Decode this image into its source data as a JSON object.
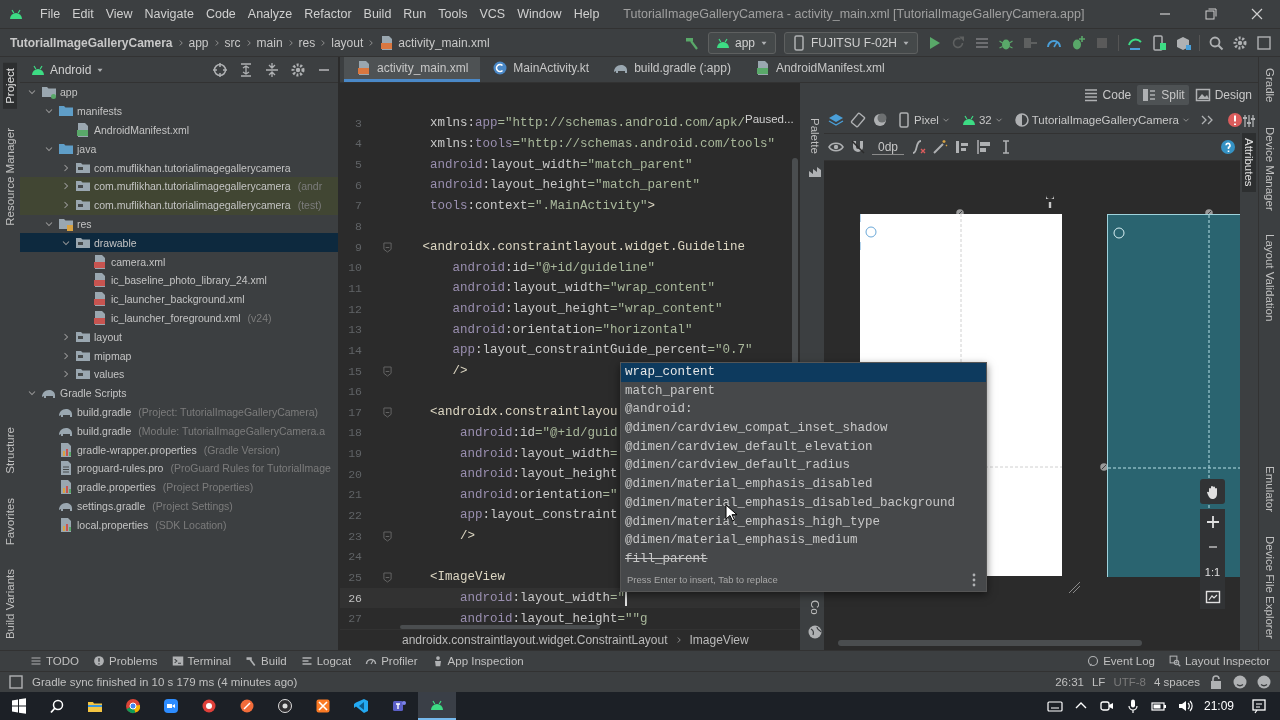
{
  "menu": [
    "File",
    "Edit",
    "View",
    "Navigate",
    "Code",
    "Analyze",
    "Refactor",
    "Build",
    "Run",
    "Tools",
    "VCS",
    "Window",
    "Help"
  ],
  "window_title": "TutorialImageGalleryCamera - activity_main.xml [TutorialImageGalleryCamera.app]",
  "breadcrumb": [
    "TutorialImageGalleryCamera",
    "app",
    "src",
    "main",
    "res",
    "layout",
    "activity_main.xml"
  ],
  "run_config": "app",
  "device": "FUJITSU F-02H",
  "project_view": "Android",
  "editor_tabs": [
    {
      "label": "activity_main.xml",
      "kind": "layout",
      "selected": true
    },
    {
      "label": "MainActivity.kt",
      "kind": "class",
      "selected": false
    },
    {
      "label": "build.gradle (:app)",
      "kind": "gradle",
      "selected": false
    },
    {
      "label": "AndroidManifest.xml",
      "kind": "manifest",
      "selected": false
    }
  ],
  "left_stripe": {
    "top": [
      {
        "label": "Project",
        "selected": true
      },
      {
        "label": "Resource Manager",
        "selected": false
      }
    ],
    "bottom": [
      {
        "label": "Structure",
        "selected": false
      },
      {
        "label": "Favorites",
        "selected": false
      },
      {
        "label": "Build Variants",
        "selected": false
      }
    ]
  },
  "right_stripe": {
    "top": [
      {
        "label": "Gradle"
      },
      {
        "label": "Device Manager"
      },
      {
        "label": "Layout Validation"
      }
    ],
    "bottom": [
      {
        "label": "Emulator"
      },
      {
        "label": "Device File Explorer"
      }
    ]
  },
  "project_tree": [
    {
      "name": "app",
      "kind": "module",
      "expanded": true,
      "selected": false,
      "tinted": false,
      "children": [
        {
          "name": "manifests",
          "kind": "source",
          "expanded": true,
          "selected": false,
          "tinted": false,
          "children": [
            {
              "name": "AndroidManifest.xml",
              "kind": "manifest",
              "selected": false,
              "tinted": false
            }
          ]
        },
        {
          "name": "java",
          "kind": "source",
          "expanded": true,
          "selected": false,
          "tinted": false,
          "children": [
            {
              "name": "com.muflikhan.tutorialimagegallerycamera",
              "kind": "package",
              "expanded": false,
              "selected": false,
              "tinted": false
            },
            {
              "name": "com.muflikhan.tutorialimagegallerycamera",
              "hint": "(andr",
              "kind": "package",
              "expanded": false,
              "selected": false,
              "tinted": true
            },
            {
              "name": "com.muflikhan.tutorialimagegallerycamera",
              "hint": "(test)",
              "kind": "package",
              "expanded": false,
              "selected": false,
              "tinted": true
            }
          ]
        },
        {
          "name": "res",
          "kind": "res",
          "expanded": true,
          "selected": false,
          "tinted": false,
          "children": [
            {
              "name": "drawable",
              "kind": "package",
              "expanded": true,
              "selected": true,
              "tinted": false,
              "children": [
                {
                  "name": "camera.xml",
                  "kind": "xml",
                  "selected": false,
                  "tinted": false
                },
                {
                  "name": "ic_baseline_photo_library_24.xml",
                  "kind": "xml",
                  "selected": false,
                  "tinted": false
                },
                {
                  "name": "ic_launcher_background.xml",
                  "kind": "xml",
                  "selected": false,
                  "tinted": false
                },
                {
                  "name": "ic_launcher_foreground.xml",
                  "hint": "(v24)",
                  "kind": "xml",
                  "selected": false,
                  "tinted": false
                }
              ]
            },
            {
              "name": "layout",
              "kind": "package",
              "expanded": false,
              "selected": false,
              "tinted": false
            },
            {
              "name": "mipmap",
              "kind": "package",
              "expanded": false,
              "selected": false,
              "tinted": false
            },
            {
              "name": "values",
              "kind": "package",
              "expanded": false,
              "selected": false,
              "tinted": false
            }
          ]
        }
      ]
    },
    {
      "name": "Gradle Scripts",
      "kind": "gradle",
      "expanded": true,
      "selected": false,
      "tinted": false,
      "children": [
        {
          "name": "build.gradle",
          "hint": "(Project: TutorialImageGalleryCamera)",
          "kind": "gradle",
          "selected": false,
          "tinted": false
        },
        {
          "name": "build.gradle",
          "hint": "(Module: TutorialImageGalleryCamera.a",
          "kind": "gradle",
          "selected": false,
          "tinted": false
        },
        {
          "name": "gradle-wrapper.properties",
          "hint": "(Gradle Version)",
          "kind": "properties",
          "selected": false,
          "tinted": false
        },
        {
          "name": "proguard-rules.pro",
          "hint": "(ProGuard Rules for TutorialImage",
          "kind": "text",
          "selected": false,
          "tinted": false
        },
        {
          "name": "gradle.properties",
          "hint": "(Project Properties)",
          "kind": "properties",
          "selected": false,
          "tinted": false
        },
        {
          "name": "settings.gradle",
          "hint": "(Project Settings)",
          "kind": "gradle",
          "selected": false,
          "tinted": false
        },
        {
          "name": "local.properties",
          "hint": "(SDK Location)",
          "kind": "properties",
          "selected": false,
          "tinted": false
        }
      ]
    }
  ],
  "code_lines": [
    {
      "number": "3",
      "current": false,
      "fold": false,
      "caret": false,
      "tokens": [
        {
          "kind": "attr",
          "text": "    xmlns:"
        },
        {
          "kind": "ns",
          "text": "app"
        },
        {
          "kind": "str",
          "text": "=\"http://schemas.android.com/apk/"
        }
      ]
    },
    {
      "number": "4",
      "current": false,
      "fold": false,
      "caret": false,
      "tokens": [
        {
          "kind": "attr",
          "text": "    xmlns:"
        },
        {
          "kind": "ns",
          "text": "tools"
        },
        {
          "kind": "str",
          "text": "=\"http://schemas.android.com/tools\""
        }
      ]
    },
    {
      "number": "5",
      "current": false,
      "fold": false,
      "caret": false,
      "tokens": [
        {
          "kind": "ns",
          "text": "    android"
        },
        {
          "kind": "attr",
          "text": ":layout_width"
        },
        {
          "kind": "str",
          "text": "=\"match_parent\""
        }
      ]
    },
    {
      "number": "6",
      "current": false,
      "fold": false,
      "caret": false,
      "tokens": [
        {
          "kind": "ns",
          "text": "    android"
        },
        {
          "kind": "attr",
          "text": ":layout_height"
        },
        {
          "kind": "str",
          "text": "=\"match_parent\""
        }
      ]
    },
    {
      "number": "7",
      "current": false,
      "fold": false,
      "caret": false,
      "tokens": [
        {
          "kind": "ns",
          "text": "    tools"
        },
        {
          "kind": "attr",
          "text": ":context"
        },
        {
          "kind": "str",
          "text": "=\".MainActivity\""
        },
        {
          "kind": "tag",
          "text": ">"
        }
      ]
    },
    {
      "number": "8",
      "current": false,
      "fold": false,
      "caret": false
    },
    {
      "number": "9",
      "current": false,
      "fold": true,
      "caret": false,
      "tokens": [
        {
          "kind": "tag",
          "text": "   <androidx.constraintlayout.widget.Guideline"
        }
      ]
    },
    {
      "number": "10",
      "current": false,
      "fold": false,
      "caret": false,
      "tokens": [
        {
          "kind": "ns",
          "text": "       android"
        },
        {
          "kind": "attr",
          "text": ":id"
        },
        {
          "kind": "str",
          "text": "=\"@+id/guideline\""
        }
      ]
    },
    {
      "number": "11",
      "current": false,
      "fold": false,
      "caret": false,
      "tokens": [
        {
          "kind": "ns",
          "text": "       android"
        },
        {
          "kind": "attr",
          "text": ":layout_width"
        },
        {
          "kind": "str",
          "text": "=\"wrap_content\""
        }
      ]
    },
    {
      "number": "12",
      "current": false,
      "fold": false,
      "caret": false,
      "tokens": [
        {
          "kind": "ns",
          "text": "       android"
        },
        {
          "kind": "attr",
          "text": ":layout_height"
        },
        {
          "kind": "str",
          "text": "=\"wrap_content\""
        }
      ]
    },
    {
      "number": "13",
      "current": false,
      "fold": false,
      "caret": false,
      "tokens": [
        {
          "kind": "ns",
          "text": "       android"
        },
        {
          "kind": "attr",
          "text": ":orientation"
        },
        {
          "kind": "str",
          "text": "=\"horizontal\""
        }
      ]
    },
    {
      "number": "14",
      "current": false,
      "fold": false,
      "caret": false,
      "tokens": [
        {
          "kind": "ns",
          "text": "       app"
        },
        {
          "kind": "attr",
          "text": ":layout_constraintGuide_percent"
        },
        {
          "kind": "str",
          "text": "=\"0.7\""
        }
      ]
    },
    {
      "number": "15",
      "current": false,
      "fold": true,
      "caret": false,
      "tokens": [
        {
          "kind": "tag",
          "text": "       />"
        }
      ]
    },
    {
      "number": "16",
      "current": false,
      "fold": false,
      "caret": false
    },
    {
      "number": "17",
      "current": false,
      "fold": true,
      "caret": false,
      "tokens": [
        {
          "kind": "tag",
          "text": "    <androidx.constraintlayou"
        }
      ]
    },
    {
      "number": "18",
      "current": false,
      "fold": false,
      "caret": false,
      "tokens": [
        {
          "kind": "ns",
          "text": "        android"
        },
        {
          "kind": "attr",
          "text": ":id"
        },
        {
          "kind": "str",
          "text": "=\"@+id/guid"
        }
      ]
    },
    {
      "number": "19",
      "current": false,
      "fold": false,
      "caret": false,
      "tokens": [
        {
          "kind": "ns",
          "text": "        android"
        },
        {
          "kind": "attr",
          "text": ":layout_width"
        },
        {
          "kind": "str",
          "text": "="
        }
      ]
    },
    {
      "number": "20",
      "current": false,
      "fold": false,
      "caret": false,
      "tokens": [
        {
          "kind": "ns",
          "text": "        android"
        },
        {
          "kind": "attr",
          "text": ":layout_height"
        }
      ]
    },
    {
      "number": "21",
      "current": false,
      "fold": false,
      "caret": false,
      "tokens": [
        {
          "kind": "ns",
          "text": "        android"
        },
        {
          "kind": "attr",
          "text": ":orientation"
        },
        {
          "kind": "str",
          "text": "=\""
        }
      ]
    },
    {
      "number": "22",
      "current": false,
      "fold": false,
      "caret": false,
      "tokens": [
        {
          "kind": "ns",
          "text": "        app"
        },
        {
          "kind": "attr",
          "text": ":layout_constraint"
        }
      ]
    },
    {
      "number": "23",
      "current": false,
      "fold": true,
      "caret": false,
      "tokens": [
        {
          "kind": "tag",
          "text": "        />"
        }
      ]
    },
    {
      "number": "24",
      "current": false,
      "fold": false,
      "caret": false
    },
    {
      "number": "25",
      "current": false,
      "fold": true,
      "caret": false,
      "tokens": [
        {
          "kind": "tag",
          "text": "    <ImageView"
        }
      ]
    },
    {
      "number": "26",
      "current": true,
      "fold": false,
      "caret": true,
      "tokens": [
        {
          "kind": "ns",
          "text": "        android"
        },
        {
          "kind": "attr",
          "text": ":layout_width"
        },
        {
          "kind": "str",
          "text": "=\""
        }
      ]
    },
    {
      "number": "27",
      "current": false,
      "fold": false,
      "caret": false,
      "tokens": [
        {
          "kind": "ns",
          "text": "        android"
        },
        {
          "kind": "attr",
          "text": ":layout_height"
        },
        {
          "kind": "str",
          "text": "=\"\"g"
        }
      ]
    }
  ],
  "paused_label": "Paused...",
  "completion": {
    "items": [
      {
        "text": "wrap_content",
        "kind": "value",
        "selected": true
      },
      {
        "text": "match_parent",
        "kind": "value",
        "selected": false
      },
      {
        "text": "@android:",
        "kind": "value",
        "selected": false
      },
      {
        "text": "@dimen/cardview_compat_inset_shadow",
        "kind": "value",
        "selected": false
      },
      {
        "text": "@dimen/cardview_default_elevation",
        "kind": "value",
        "selected": false
      },
      {
        "text": "@dimen/cardview_default_radius",
        "kind": "value",
        "selected": false
      },
      {
        "text": "@dimen/material_emphasis_disabled",
        "kind": "value",
        "selected": false
      },
      {
        "text": "@dimen/material_emphasis_disabled_background",
        "kind": "value",
        "selected": false
      },
      {
        "text": "@dimen/material_emphasis_high_type",
        "kind": "value",
        "selected": false
      },
      {
        "text": "@dimen/material_emphasis_medium",
        "kind": "value",
        "selected": false
      },
      {
        "text": "fill_parent",
        "kind": "deprecated",
        "selected": false
      }
    ],
    "footer": "Press Enter to insert, Tab to replace"
  },
  "editor_breadcrumb": [
    "androidx.constraintlayout.widget.ConstraintLayout",
    "ImageView"
  ],
  "design": {
    "modes": [
      {
        "label": "Code",
        "kind": "code",
        "selected": false
      },
      {
        "label": "Split",
        "kind": "split",
        "selected": true
      },
      {
        "label": "Design",
        "kind": "design",
        "selected": false
      }
    ],
    "palette_label": "Palette",
    "component_tree_label": "Co",
    "attributes_label": "Attributes",
    "device": "Pixel",
    "api": "32",
    "theme": "TutorialImageGalleryCamera",
    "default_margin": "0dp",
    "zoom_label": "1:1"
  },
  "tool_windows": {
    "left": [
      {
        "label": "TODO",
        "kind": "todo"
      },
      {
        "label": "Problems",
        "kind": "problems"
      },
      {
        "label": "Terminal",
        "kind": "terminal"
      },
      {
        "label": "Build",
        "kind": "build"
      },
      {
        "label": "Logcat",
        "kind": "logcat"
      },
      {
        "label": "Profiler",
        "kind": "profiler"
      },
      {
        "label": "App Inspection",
        "kind": "inspection"
      }
    ],
    "right": [
      {
        "label": "Event Log",
        "kind": "log"
      },
      {
        "label": "Layout Inspector",
        "kind": "inspector"
      }
    ]
  },
  "status": {
    "message": "Gradle sync finished in 10 s 179 ms (4 minutes ago)",
    "position": "26:31",
    "line_separator": "LF",
    "encoding": "UTF-8",
    "indent": "4 spaces"
  },
  "taskbar": {
    "apps": [
      {
        "kind": "files",
        "selected": false
      },
      {
        "kind": "browser",
        "selected": false
      },
      {
        "kind": "video",
        "selected": false
      },
      {
        "kind": "red",
        "selected": false
      },
      {
        "kind": "orange",
        "selected": false
      },
      {
        "kind": "recorder",
        "selected": false
      },
      {
        "kind": "server",
        "selected": false
      },
      {
        "kind": "code",
        "selected": false
      },
      {
        "kind": "chat",
        "selected": false
      },
      {
        "kind": "studio",
        "selected": true
      }
    ],
    "clock": "21:09"
  }
}
